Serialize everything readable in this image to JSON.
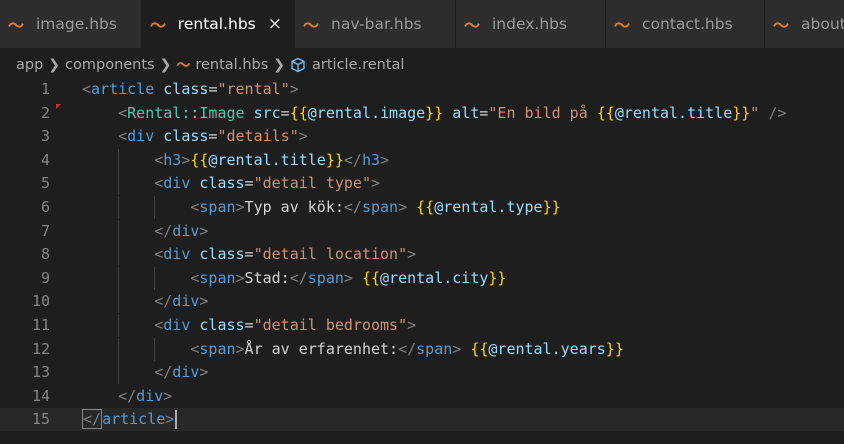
{
  "tabs": [
    {
      "label": "image.hbs",
      "active": false
    },
    {
      "label": "rental.hbs",
      "active": true
    },
    {
      "label": "nav-bar.hbs",
      "active": false
    },
    {
      "label": "index.hbs",
      "active": false
    },
    {
      "label": "contact.hbs",
      "active": false
    },
    {
      "label": "about",
      "active": false
    }
  ],
  "tab_close_glyph": "×",
  "file_icon_glyph": "〜",
  "breadcrumb": {
    "parts": [
      "app",
      "components",
      "rental.hbs",
      "article.rental"
    ]
  },
  "colors": {
    "editor_bg": "#1e1e1e",
    "tab_inactive_bg": "#2d2d2d",
    "hbs_icon": "#e37933",
    "tag": "#569cd6",
    "attribute": "#9cdcfe",
    "string": "#ce9178",
    "brace": "#ffd700",
    "component": "#4ec9b0"
  },
  "line_numbers": [
    "1",
    "2",
    "3",
    "4",
    "5",
    "6",
    "7",
    "8",
    "9",
    "10",
    "11",
    "12",
    "13",
    "14",
    "15"
  ],
  "code_lines": [
    {
      "indent": 0,
      "tokens": [
        [
          "p",
          "<"
        ],
        [
          "t",
          "article"
        ],
        [
          "x",
          " "
        ],
        [
          "a",
          "class"
        ],
        [
          "x",
          "="
        ],
        [
          "s",
          "\"rental\""
        ],
        [
          "p",
          ">"
        ]
      ]
    },
    {
      "indent": 1,
      "tokens": [
        [
          "p",
          "<"
        ],
        [
          "c",
          "Rental::Image"
        ],
        [
          "x",
          " "
        ],
        [
          "a",
          "src"
        ],
        [
          "x",
          "="
        ],
        [
          "b",
          "{{"
        ],
        [
          "h",
          "@rental.image"
        ],
        [
          "b",
          "}}"
        ],
        [
          "x",
          " "
        ],
        [
          "a",
          "alt"
        ],
        [
          "x",
          "="
        ],
        [
          "s",
          "\"En bild på "
        ],
        [
          "b",
          "{{"
        ],
        [
          "h",
          "@rental.title"
        ],
        [
          "b",
          "}}"
        ],
        [
          "s",
          "\""
        ],
        [
          "x",
          " "
        ],
        [
          "p",
          "/>"
        ]
      ]
    },
    {
      "indent": 1,
      "tokens": [
        [
          "p",
          "<"
        ],
        [
          "t",
          "div"
        ],
        [
          "x",
          " "
        ],
        [
          "a",
          "class"
        ],
        [
          "x",
          "="
        ],
        [
          "s",
          "\"details\""
        ],
        [
          "p",
          ">"
        ]
      ]
    },
    {
      "indent": 2,
      "tokens": [
        [
          "p",
          "<"
        ],
        [
          "t",
          "h3"
        ],
        [
          "p",
          ">"
        ],
        [
          "b",
          "{{"
        ],
        [
          "h",
          "@rental.title"
        ],
        [
          "b",
          "}}"
        ],
        [
          "p",
          "</"
        ],
        [
          "t",
          "h3"
        ],
        [
          "p",
          ">"
        ]
      ]
    },
    {
      "indent": 2,
      "tokens": [
        [
          "p",
          "<"
        ],
        [
          "t",
          "div"
        ],
        [
          "x",
          " "
        ],
        [
          "a",
          "class"
        ],
        [
          "x",
          "="
        ],
        [
          "s",
          "\"detail type\""
        ],
        [
          "p",
          ">"
        ]
      ]
    },
    {
      "indent": 3,
      "tokens": [
        [
          "p",
          "<"
        ],
        [
          "t",
          "span"
        ],
        [
          "p",
          ">"
        ],
        [
          "x",
          "Typ av kök:"
        ],
        [
          "p",
          "</"
        ],
        [
          "t",
          "span"
        ],
        [
          "p",
          ">"
        ],
        [
          "x",
          " "
        ],
        [
          "b",
          "{{"
        ],
        [
          "h",
          "@rental.type"
        ],
        [
          "b",
          "}}"
        ]
      ]
    },
    {
      "indent": 2,
      "tokens": [
        [
          "p",
          "</"
        ],
        [
          "t",
          "div"
        ],
        [
          "p",
          ">"
        ]
      ]
    },
    {
      "indent": 2,
      "tokens": [
        [
          "p",
          "<"
        ],
        [
          "t",
          "div"
        ],
        [
          "x",
          " "
        ],
        [
          "a",
          "class"
        ],
        [
          "x",
          "="
        ],
        [
          "s",
          "\"detail location\""
        ],
        [
          "p",
          ">"
        ]
      ]
    },
    {
      "indent": 3,
      "tokens": [
        [
          "p",
          "<"
        ],
        [
          "t",
          "span"
        ],
        [
          "p",
          ">"
        ],
        [
          "x",
          "Stad:"
        ],
        [
          "p",
          "</"
        ],
        [
          "t",
          "span"
        ],
        [
          "p",
          ">"
        ],
        [
          "x",
          " "
        ],
        [
          "b",
          "{{"
        ],
        [
          "h",
          "@rental.city"
        ],
        [
          "b",
          "}}"
        ]
      ]
    },
    {
      "indent": 2,
      "tokens": [
        [
          "p",
          "</"
        ],
        [
          "t",
          "div"
        ],
        [
          "p",
          ">"
        ]
      ]
    },
    {
      "indent": 2,
      "tokens": [
        [
          "p",
          "<"
        ],
        [
          "t",
          "div"
        ],
        [
          "x",
          " "
        ],
        [
          "a",
          "class"
        ],
        [
          "x",
          "="
        ],
        [
          "s",
          "\"detail bedrooms\""
        ],
        [
          "p",
          ">"
        ]
      ]
    },
    {
      "indent": 3,
      "tokens": [
        [
          "p",
          "<"
        ],
        [
          "t",
          "span"
        ],
        [
          "p",
          ">"
        ],
        [
          "x",
          "År av erfarenhet:"
        ],
        [
          "p",
          "</"
        ],
        [
          "t",
          "span"
        ],
        [
          "p",
          ">"
        ],
        [
          "x",
          " "
        ],
        [
          "b",
          "{{"
        ],
        [
          "h",
          "@rental.years"
        ],
        [
          "b",
          "}}"
        ]
      ]
    },
    {
      "indent": 2,
      "tokens": [
        [
          "p",
          "</"
        ],
        [
          "t",
          "div"
        ],
        [
          "p",
          ">"
        ]
      ]
    },
    {
      "indent": 1,
      "tokens": [
        [
          "p",
          "</"
        ],
        [
          "t",
          "div"
        ],
        [
          "p",
          ">"
        ]
      ]
    },
    {
      "indent": 0,
      "tokens": [
        [
          "p",
          "</"
        ],
        [
          "t",
          "article"
        ],
        [
          "p",
          ">"
        ]
      ]
    }
  ]
}
